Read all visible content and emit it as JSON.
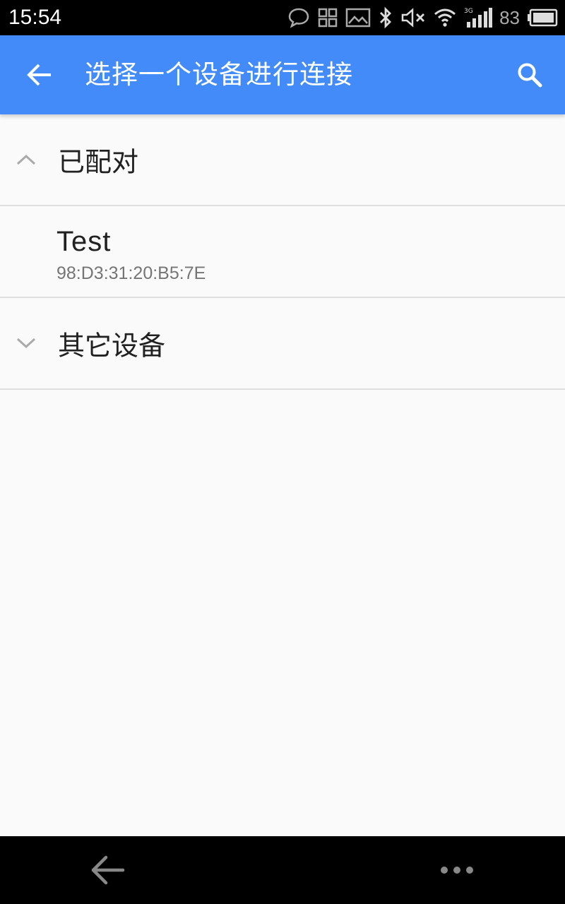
{
  "status_bar": {
    "time": "15:54",
    "battery_percent": "83",
    "network_type": "3G",
    "icons": [
      "chat-bubble-icon",
      "grid-app-icon",
      "image-icon",
      "bluetooth-icon",
      "mute-icon",
      "wifi-icon",
      "signal-icon",
      "battery-icon"
    ]
  },
  "app_bar": {
    "title": "选择一个设备进行连接",
    "back_icon": "arrow-back-icon",
    "search_icon": "search-icon",
    "background_color": "#428bf9"
  },
  "groups": [
    {
      "label": "已配对",
      "expanded": true,
      "chevron_icon": "chevron-up-icon",
      "devices": [
        {
          "name": "Test",
          "address": "98:D3:31:20:B5:7E"
        }
      ]
    },
    {
      "label": "其它设备",
      "expanded": false,
      "chevron_icon": "chevron-down-icon",
      "devices": []
    }
  ],
  "nav_bar": {
    "back_icon": "nav-back-icon",
    "more_icon": "more-dots-icon"
  }
}
